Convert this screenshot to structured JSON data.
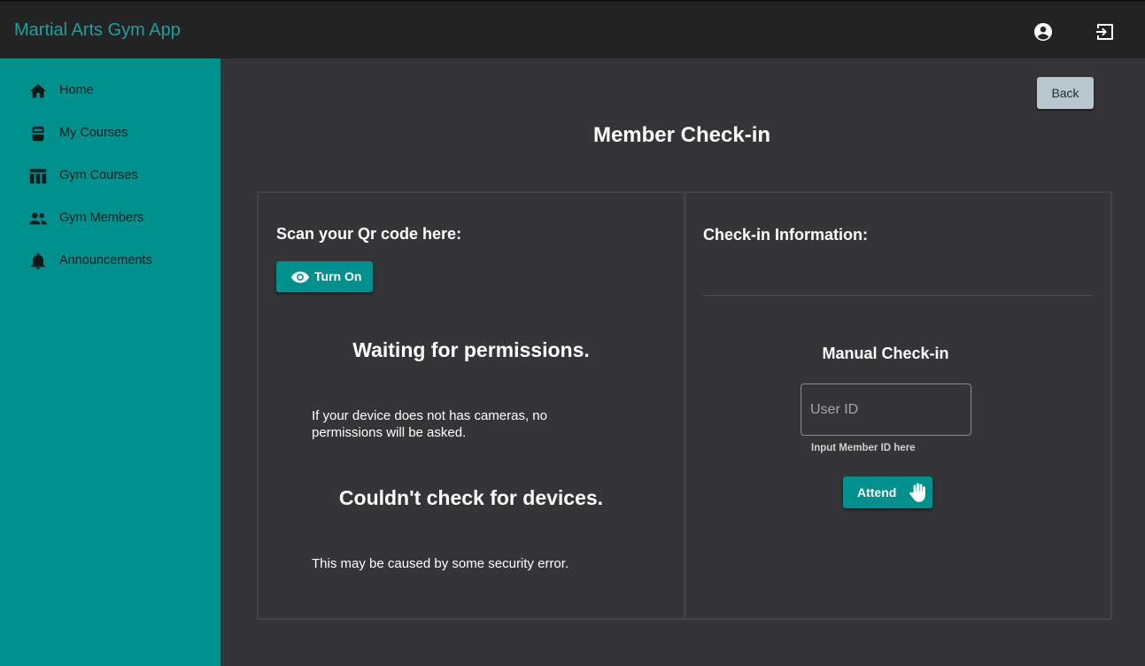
{
  "header": {
    "app_title": "Martial Arts Gym App",
    "icons": [
      "account-circle-icon",
      "logout-icon"
    ]
  },
  "sidebar": {
    "items": [
      {
        "label": "Home",
        "icon": "home-icon"
      },
      {
        "label": "My Courses",
        "icon": "karate-gi-icon"
      },
      {
        "label": "Gym Courses",
        "icon": "table-icon"
      },
      {
        "label": "Gym Members",
        "icon": "people-icon"
      },
      {
        "label": "Announcements",
        "icon": "bell-icon"
      }
    ]
  },
  "main": {
    "back_label": "Back",
    "title": "Member Check-in",
    "scan": {
      "title": "Scan your Qr code here:",
      "turn_on_label": "Turn On",
      "waiting_heading": "Waiting for permissions.",
      "waiting_text": "If your device does not has cameras, no permissions will be asked.",
      "error_heading": "Couldn't check for devices.",
      "error_text": "This may be caused by some security error."
    },
    "checkin": {
      "title": "Check-in Information:",
      "manual_title": "Manual Check-in",
      "user_id_placeholder": "User ID",
      "user_id_value": "",
      "helper_text": "Input Member ID here",
      "attend_label": "Attend"
    }
  },
  "colors": {
    "accent": "#00908e",
    "title_accent": "#16a3a0",
    "topbar": "#232323",
    "background": "#353537",
    "back_button": "#b8c6ce"
  }
}
